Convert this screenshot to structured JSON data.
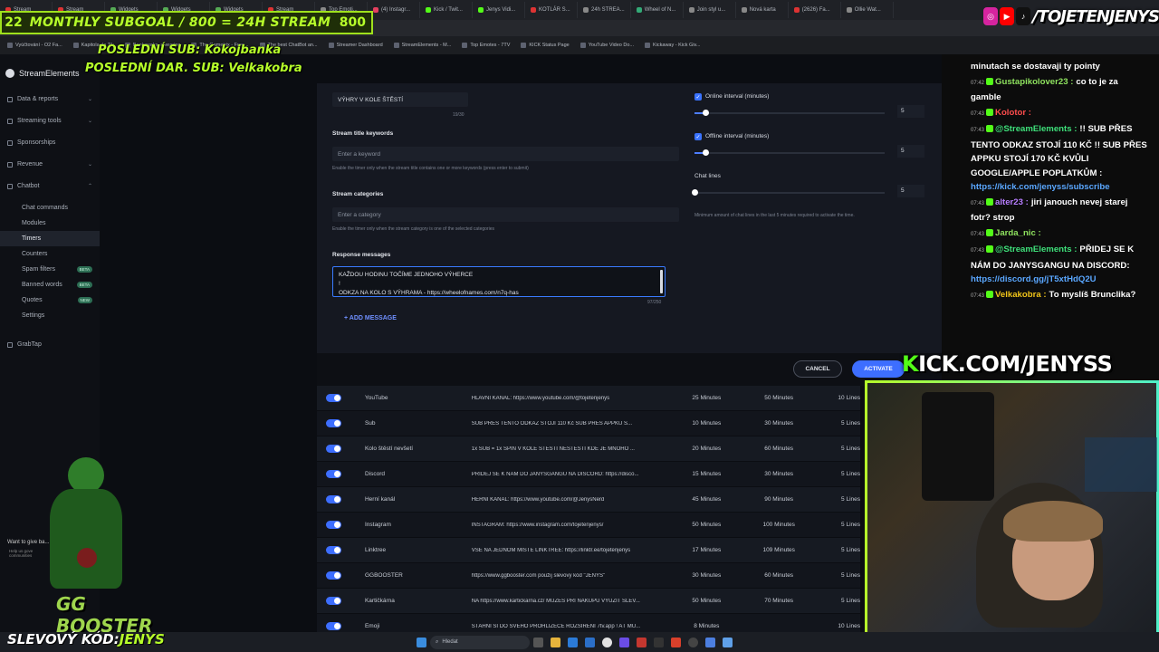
{
  "browser": {
    "tabs": [
      "Stream",
      "Stream",
      "Widgets",
      "Widgets",
      "Widgets",
      "Stream",
      "Top Emoti...",
      "(4) Instagr...",
      "Kick / Twit...",
      "Jenys Vidi...",
      "KOTLÁR S...",
      "24h STREA...",
      "Wheel of N...",
      "Join styl u...",
      "Nová karta",
      "(2626) Fa...",
      "Ollie Wat..."
    ],
    "bookmarks": [
      "Vyúčtování - O2 Fa...",
      "Kapitola do Tik",
      "Bookmarks, swearing",
      "The Gametrix - Free...",
      "The best ChatBot an...",
      "Streamer Dashboard",
      "StreamElements - M...",
      "Top Emotes - 7TV",
      "KICK Status Page",
      "YouTube Video Do...",
      "Kickaway - Kick Giv..."
    ]
  },
  "overlay": {
    "goal_left": "22",
    "goal_text": "MONTHLY SUBGOAL / 800 = 24H STREAM",
    "goal_right": "800",
    "last_sub": "POSLEDNÍ SUB: Kokojbanka",
    "last_donation": "POSLEDNÍ DAR. SUB: Velkakobra",
    "kick_url": "KICK.COM/JENYSS",
    "socials_handle": "/TOJETENJENYS",
    "discount_prefix": "SLEVOVÝ KÓD:",
    "discount_code": "JENYS",
    "booster_text": "GG BOOSTER",
    "want_to_give": "Want to give ba...",
    "help_text": "Help us gove communities"
  },
  "sidebar": {
    "brand": "StreamElements",
    "items": [
      {
        "label": "Data & reports",
        "chevron": "⌄"
      },
      {
        "label": "Streaming tools",
        "chevron": "⌄"
      },
      {
        "label": "Sponsorships",
        "chevron": ""
      },
      {
        "label": "Revenue",
        "chevron": "⌄"
      },
      {
        "label": "Chatbot",
        "chevron": "⌃"
      }
    ],
    "chatbot_sub": [
      {
        "label": "Chat commands",
        "badge": ""
      },
      {
        "label": "Modules",
        "badge": ""
      },
      {
        "label": "Timers",
        "badge": ""
      },
      {
        "label": "Counters",
        "badge": ""
      },
      {
        "label": "Spam filters",
        "badge": "BETA"
      },
      {
        "label": "Banned words",
        "badge": "BETA"
      },
      {
        "label": "Quotes",
        "badge": "NEW"
      },
      {
        "label": "Settings",
        "badge": ""
      }
    ],
    "grabtap": "GrabTap"
  },
  "form": {
    "name_value": "VÝHRY V KOLE ŠTĚSTÍ",
    "name_counter": "19/30",
    "keywords_label": "Stream title keywords",
    "keywords_placeholder": "Enter a keyword",
    "keywords_hint": "Enable the timer only when the stream title contains one or more keywords (press enter to submit)",
    "categories_label": "Stream categories",
    "categories_placeholder": "Enter a category",
    "categories_hint": "Enable the timer only when the stream category is one of the selected categories",
    "responses_label": "Response messages",
    "response_line1": "KAŽDOU HODINU TOČÍME JEDNOHO VÝHERCE",
    "response_line2": "!",
    "response_line3": "ODKZA NA KOLO S VÝHRAMA - https://wheelofnames.com/n7q-has",
    "response_counter": "97/250",
    "add_message": "+ ADD MESSAGE",
    "online_label": "Online interval (minutes)",
    "online_value": "5",
    "online_level": 0.03,
    "offline_label": "Offline interval (minutes)",
    "offline_value": "5",
    "offline_level": 0.03,
    "chatlines_label": "Chat lines",
    "chatlines_value": "5",
    "chatlines_hint": "Minimum amount of chat lines in the last 5 minutes required to activate the time.",
    "cancel": "CANCEL",
    "activate": "ACTIVATE"
  },
  "timers": [
    {
      "name": "YouTube",
      "msg": "HLAVNÍ KANÁL: https://www.youtube.com/@tojetenjenys",
      "online": "25 Minutes",
      "offline": "50 Minutes",
      "lines": "10 Lines"
    },
    {
      "name": "Sub",
      "msg": "SUB PŘES TENTO ODKAZ STOJÍ 110 Kč SUB PŘES APPKU S...",
      "online": "10 Minutes",
      "offline": "30 Minutes",
      "lines": "5 Lines"
    },
    {
      "name": "Kolo štěstí nevšetí",
      "msg": "1x SUB = 1x SPIN V KOLE ŠTĚSTÍ NEŠTĚSTÍ KDE JE MNOHO ...",
      "online": "20 Minutes",
      "offline": "60 Minutes",
      "lines": "5 Lines"
    },
    {
      "name": "Discord",
      "msg": "PŘIDEJ SE K NÁM DO JANYSGANGU NA DISCORD: https://disco...",
      "online": "15 Minutes",
      "offline": "30 Minutes",
      "lines": "5 Lines"
    },
    {
      "name": "Herní kanál",
      "msg": "HERNÍ KANÁL: https://www.youtube.com/@JenysNerd",
      "online": "45 Minutes",
      "offline": "90 Minutes",
      "lines": "5 Lines"
    },
    {
      "name": "Instagram",
      "msg": "INSTAGRAM: https://www.instagram.com/tojetenjenys/",
      "online": "50 Minutes",
      "offline": "100 Minutes",
      "lines": "5 Lines"
    },
    {
      "name": "Linktree",
      "msg": "VŠE NA JEDNOM MÍSTĚ LINKTREE: https://linktr.ee/tojetenjenys",
      "online": "17 Minutes",
      "offline": "109 Minutes",
      "lines": "5 Lines"
    },
    {
      "name": "GGBOOSTER",
      "msg": "https://www.ggbooster.com použij slevový kód \"JENYS\"",
      "online": "30 Minutes",
      "offline": "60 Minutes",
      "lines": "5 Lines"
    },
    {
      "name": "Kartičkárna",
      "msg": "NA https://www.kartickarna.cz/ MŮŽEŠ PŘI NÁKUPU VYUŽÍT SLEV...",
      "online": "50 Minutes",
      "offline": "70 Minutes",
      "lines": "5 Lines"
    },
    {
      "name": "Emoji",
      "msg": "STÁHNI SI DO SVÉHO PROHLÍŽEČE ROZŠÍŘENÍ 7tv.app ! AŤ MŮ...",
      "online": "8 Minutes",
      "offline": "",
      "lines": "10 Lines"
    }
  ],
  "chat": [
    {
      "time": "",
      "user": "",
      "color": "#ffffff",
      "text": "minutach se dostavaji ty pointy",
      "link": ""
    },
    {
      "time": "07:42",
      "user": "Gustapikolover23 :",
      "color": "#8fe35f",
      "text": "co to je za gamble",
      "link": ""
    },
    {
      "time": "07:43",
      "user": "Kolotor :",
      "color": "#ff4d4d",
      "text": "",
      "link": ""
    },
    {
      "time": "07:43",
      "user": "@StreamElements :",
      "color": "#3ee07a",
      "text": "!! SUB PŘES TENTO ODKAZ STOJÍ 110 KČ !! SUB PŘES APPKU STOJÍ 170 KČ KVŮLI GOOGLE/APPLE POPLATKŮM :",
      "link": "https://kick.com/jenyss/subscribe"
    },
    {
      "time": "07:43",
      "user": "alter23 :",
      "color": "#b77dff",
      "text": "jiri janouch nevej starej fotr? strop",
      "link": ""
    },
    {
      "time": "07:43",
      "user": "Jarda_nic :",
      "color": "#8fe35f",
      "text": "",
      "link": ""
    },
    {
      "time": "07:43",
      "user": "@StreamElements :",
      "color": "#3ee07a",
      "text": "PŘIDEJ SE K NÁM DO JANYSGANGU NA DISCORD:",
      "link": "https://discord.gg/jT5xtHdQ2U"
    },
    {
      "time": "07:43",
      "user": "Velkakobra :",
      "color": "#f0c419",
      "text": "To myslíš Brunclika?",
      "link": ""
    }
  ],
  "taskbar": {
    "search_placeholder": "Hledat"
  },
  "colors": {
    "accent": "#3d6eff",
    "kick_green": "#b6ff2a"
  }
}
